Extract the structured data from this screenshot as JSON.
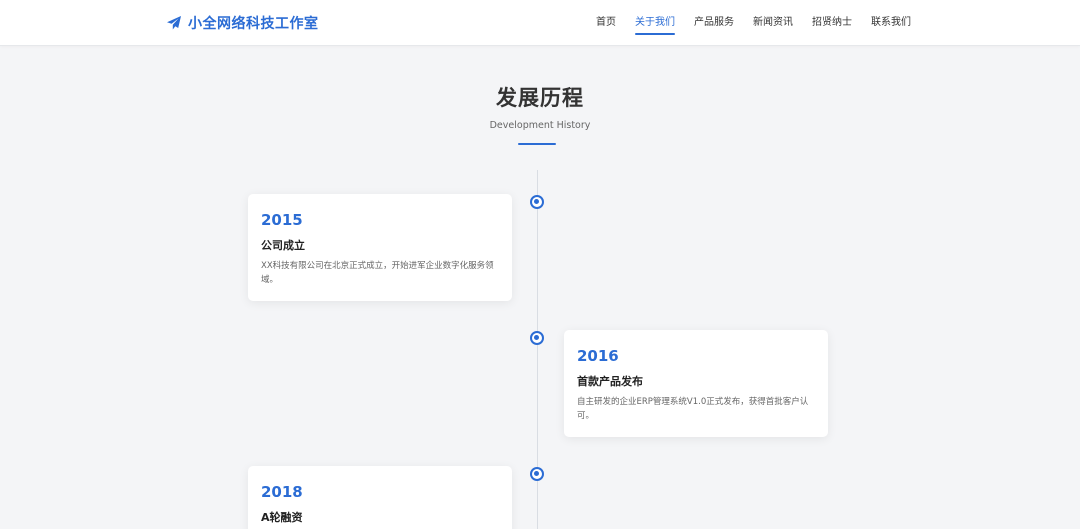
{
  "header": {
    "brand": {
      "icon": "paper-plane-icon",
      "name": "小全网络科技工作室"
    },
    "nav": [
      {
        "label": "首页",
        "active": false
      },
      {
        "label": "关于我们",
        "active": true
      },
      {
        "label": "产品服务",
        "active": false
      },
      {
        "label": "新闻资讯",
        "active": false
      },
      {
        "label": "招贤纳士",
        "active": false
      },
      {
        "label": "联系我们",
        "active": false
      }
    ]
  },
  "section": {
    "title": "发展历程",
    "subtitle": "Development History"
  },
  "timeline": [
    {
      "year": "2015",
      "title": "公司成立",
      "desc": "XX科技有限公司在北京正式成立，开始进军企业数字化服务领域。",
      "side": "left"
    },
    {
      "year": "2016",
      "title": "首款产品发布",
      "desc": "自主研发的企业ERP管理系统V1.0正式发布，获得首批客户认可。",
      "side": "right"
    },
    {
      "year": "2018",
      "title": "A轮融资",
      "desc": "",
      "side": "left"
    }
  ],
  "colors": {
    "accent": "#2b6cd4",
    "background": "#f4f5f7",
    "card": "#ffffff"
  }
}
